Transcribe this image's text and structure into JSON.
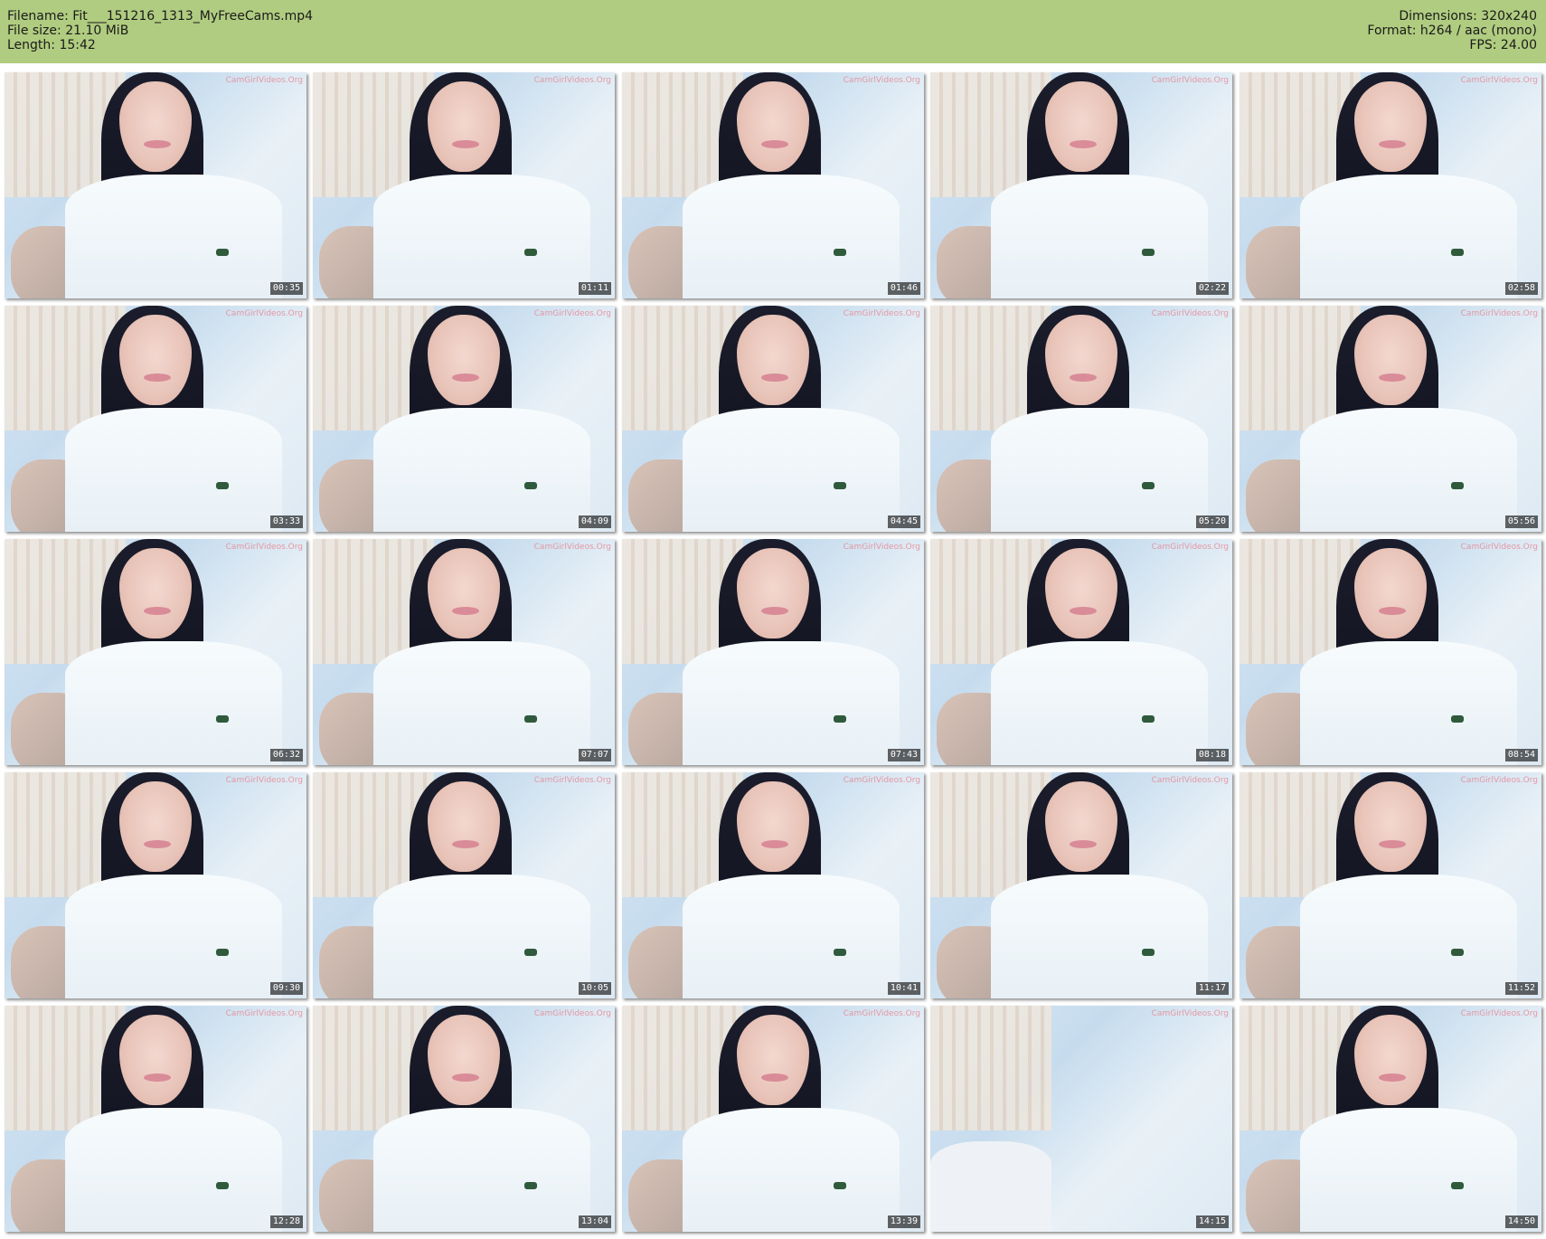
{
  "header": {
    "filename": "Filename: Fit___151216_1313_MyFreeCams.mp4",
    "filesize": "File size: 21.10 MiB",
    "length": "Length: 15:42",
    "dimensions": "Dimensions: 320x240",
    "format": "Format: h264 / aac (mono)",
    "fps": "FPS: 24.00",
    "background_color": "#b0cc80"
  },
  "watermark": "CamGirlVideos.Org",
  "thumbnails": [
    {
      "timestamp": "00:35"
    },
    {
      "timestamp": "01:11"
    },
    {
      "timestamp": "01:46"
    },
    {
      "timestamp": "02:22"
    },
    {
      "timestamp": "02:58"
    },
    {
      "timestamp": "03:33"
    },
    {
      "timestamp": "04:09"
    },
    {
      "timestamp": "04:45"
    },
    {
      "timestamp": "05:20"
    },
    {
      "timestamp": "05:56"
    },
    {
      "timestamp": "06:32"
    },
    {
      "timestamp": "07:07"
    },
    {
      "timestamp": "07:43"
    },
    {
      "timestamp": "08:18"
    },
    {
      "timestamp": "08:54"
    },
    {
      "timestamp": "09:30"
    },
    {
      "timestamp": "10:05"
    },
    {
      "timestamp": "10:41"
    },
    {
      "timestamp": "11:17"
    },
    {
      "timestamp": "11:52"
    },
    {
      "timestamp": "12:28"
    },
    {
      "timestamp": "13:04"
    },
    {
      "timestamp": "13:39"
    },
    {
      "timestamp": "14:15"
    },
    {
      "timestamp": "14:50"
    }
  ]
}
